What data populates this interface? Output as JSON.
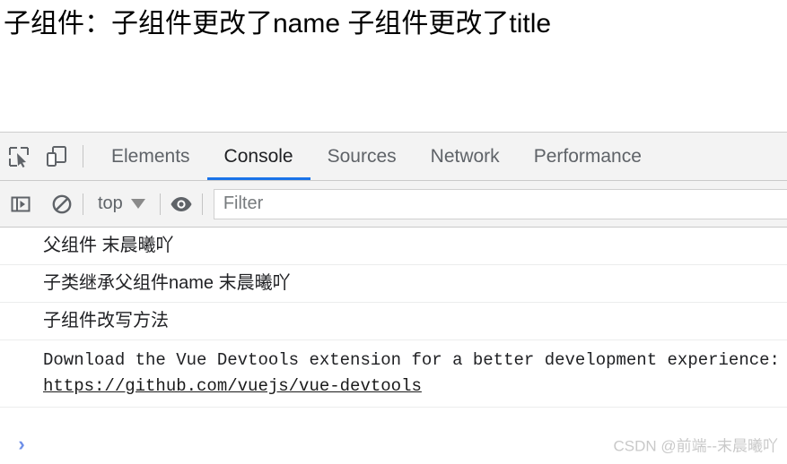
{
  "page": {
    "heading": "子组件：子组件更改了name 子组件更改了title"
  },
  "devtools": {
    "toolbar": {
      "inspect_icon": "inspect-element-icon",
      "device_icon": "device-toolbar-icon"
    },
    "tabs": [
      {
        "label": "Elements",
        "active": false
      },
      {
        "label": "Console",
        "active": true
      },
      {
        "label": "Sources",
        "active": false
      },
      {
        "label": "Network",
        "active": false
      },
      {
        "label": "Performance",
        "active": false
      }
    ],
    "filterbar": {
      "sidebar_icon": "console-sidebar-icon",
      "clear_icon": "clear-console-icon",
      "context": "top",
      "eye_icon": "live-expression-eye-icon",
      "filter_placeholder": "Filter",
      "filter_value": ""
    },
    "console_messages": [
      {
        "text": "父组件 末晨曦吖",
        "mono": false
      },
      {
        "text": "子类继承父组件name 末晨曦吖",
        "mono": false
      },
      {
        "text": "子组件改写方法",
        "mono": false
      }
    ],
    "vue_message": {
      "text": "Download the Vue Devtools extension for a better development experience:",
      "link": "https://github.com/vuejs/vue-devtools"
    },
    "prompt": {
      "caret": "›",
      "value": ""
    },
    "watermark": "CSDN @前端--末晨曦吖"
  },
  "colors": {
    "accent": "#1a73e8",
    "toolbar_bg": "#f3f3f3",
    "text": "#202124",
    "muted": "#5f6368",
    "prompt": "#6e8fe8",
    "watermark": "#c9c9c9"
  }
}
